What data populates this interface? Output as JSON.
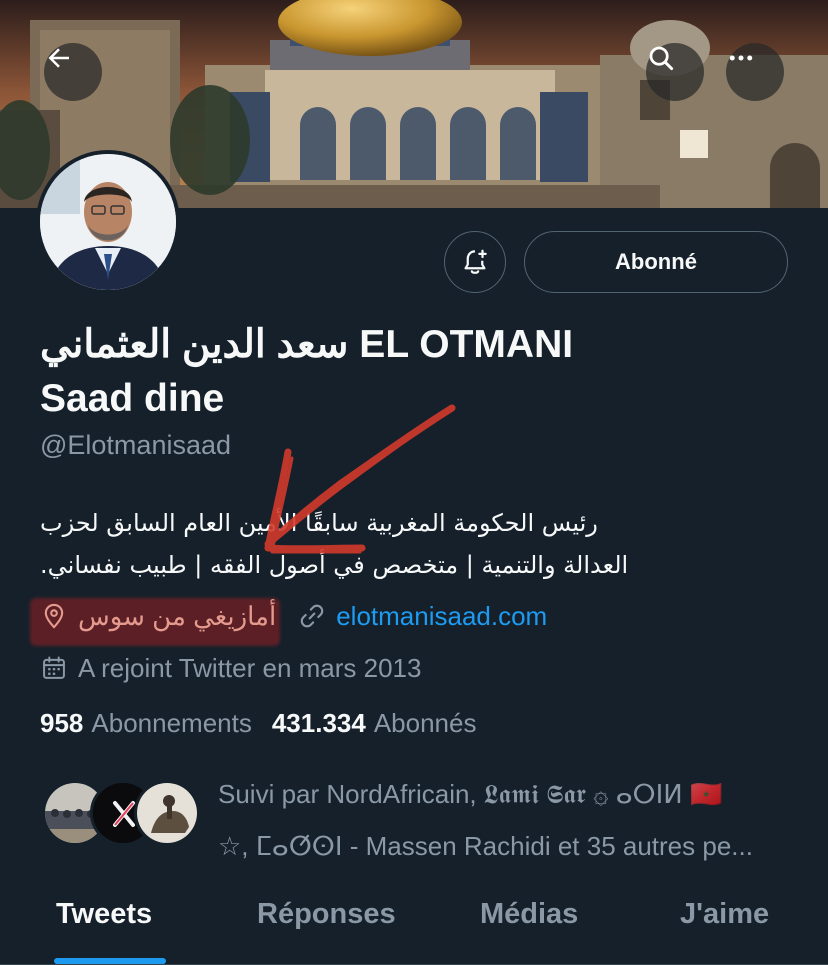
{
  "header": {
    "back_icon": "arrow-left-icon",
    "search_icon": "search-icon",
    "more_icon": "more-horizontal-icon"
  },
  "profile": {
    "name": "سعد الدين العثماني EL OTMANI\nSaad dine",
    "handle": "@Elotmanisaad",
    "bio_lines": [
      "رئيس الحكومة المغربية سابقًا الأمين العام السابق لحزب",
      "العدالة والتنمية | متخصص في أصول الفقه | طبيب نفساني."
    ],
    "location": "أمازيغي من سوس",
    "website": "elotmanisaad.com",
    "joined": "A rejoint Twitter en mars 2013",
    "following_count": "958",
    "following_label": "Abonnements",
    "followers_count": "431.334",
    "followers_label": "Abonnés"
  },
  "actions": {
    "follow_label": "Abonné",
    "bell_icon": "bell-plus-icon"
  },
  "followed_by": {
    "line1": "Suivi par NordAfricain, 𝕷𝖆𝖒𝖎 𝕾𝖆𝖗 ۞ ⴰⵔⵏⵍ 🇲🇦",
    "line2": "☆, ⵎⴰⵚⵙⵏ - Massen Rachidi et 35 autres pe..."
  },
  "tabs": [
    {
      "label": "Tweets",
      "active": true
    },
    {
      "label": "Réponses",
      "active": false
    },
    {
      "label": "Médias",
      "active": false
    },
    {
      "label": "J'aime",
      "active": false
    }
  ],
  "colors": {
    "background": "#15202b",
    "accent": "#1d9bf0",
    "muted": "#8b98a5",
    "annotation_red": "#d23a2c"
  }
}
